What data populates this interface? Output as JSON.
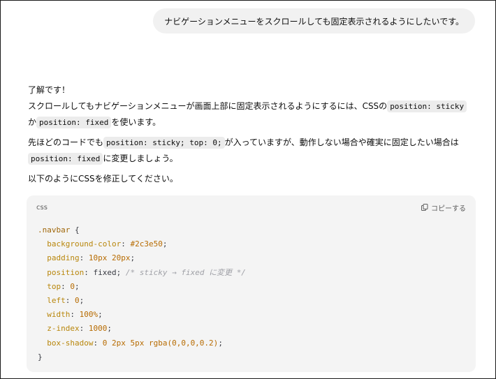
{
  "user_message": "ナビゲーションメニューをスクロールしても固定表示されるようにしたいです。",
  "assistant": {
    "line1": "了解です！",
    "line2_a": "スクロールしてもナビゲーションメニューが画面上部に固定表示されるようにするには、CSSの",
    "code_sticky": "position: sticky",
    "line2_b": "か",
    "code_fixed": "position: fixed",
    "line2_c": "を使います。",
    "p2_a": "先ほどのコードでも",
    "code_sticky_top": "position: sticky; top: 0;",
    "p2_b": "が入っていますが、動作しない場合や確実に固定したい場合は",
    "code_fixed2": "position: fixed",
    "p2_c": "に変更しましょう。",
    "p3": "以下のようにCSSを修正してください。"
  },
  "code_block": {
    "language": "css",
    "copy_label": "コピーする",
    "selector": ".navbar",
    "open_brace": "{",
    "close_brace": "}",
    "lines": [
      {
        "prop": "background-color",
        "value": "#2c3e50"
      },
      {
        "prop": "padding",
        "value": "10px 20px"
      },
      {
        "prop": "position",
        "value": "fixed",
        "comment": "/* sticky → fixed に変更 */"
      },
      {
        "prop": "top",
        "value": "0"
      },
      {
        "prop": "left",
        "value": "0"
      },
      {
        "prop": "width",
        "value": "100%"
      },
      {
        "prop": "z-index",
        "value": "1000"
      },
      {
        "prop": "box-shadow",
        "value": "0 2px 5px rgba(0,0,0,0.2)"
      }
    ]
  }
}
